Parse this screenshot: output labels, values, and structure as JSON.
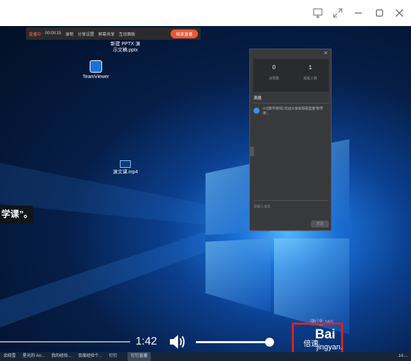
{
  "window": {
    "buttons": [
      "pin-icon",
      "expand-icon",
      "minimize-icon",
      "maximize-icon",
      "close-icon"
    ]
  },
  "recording_bar": {
    "status": "直播中",
    "timer": "00:00:15",
    "items": [
      "录制",
      "分享设置",
      "屏幕共享",
      "互动面板"
    ],
    "end_button": "结束直播"
  },
  "desktop_icons": [
    {
      "label": "新建 PPTX 演示文稿.pptx",
      "icon": "pptx-icon"
    },
    {
      "label": "TeamViewer",
      "icon": "teamviewer-icon"
    },
    {
      "label": "演文课.mp4",
      "icon": "video-file-icon"
    }
  ],
  "subtitle": "学课”。",
  "chat_panel": {
    "stats": [
      {
        "value": "0",
        "label": "点赞数"
      },
      {
        "value": "1",
        "label": "观看人数"
      }
    ],
    "messages_title": "消息",
    "message": "小2[数学老师] 欢迎大家来观看直播“数学课”。",
    "input_placeholder": "请输入消息",
    "send_label": "发送"
  },
  "player": {
    "time": "1:42",
    "volume": 1.0,
    "speed_label": "倍速"
  },
  "watermark": {
    "line1": "激活 Wi",
    "baidu": "Bai",
    "jingyan": "jingyan."
  },
  "taskbar": {
    "items": [
      "余晓雪",
      "星光的 An...",
      "我的经验...",
      "百度经验个...",
      "钉钉",
      "",
      "钉钉直播"
    ],
    "active_index": 6,
    "clock": "14:..."
  }
}
